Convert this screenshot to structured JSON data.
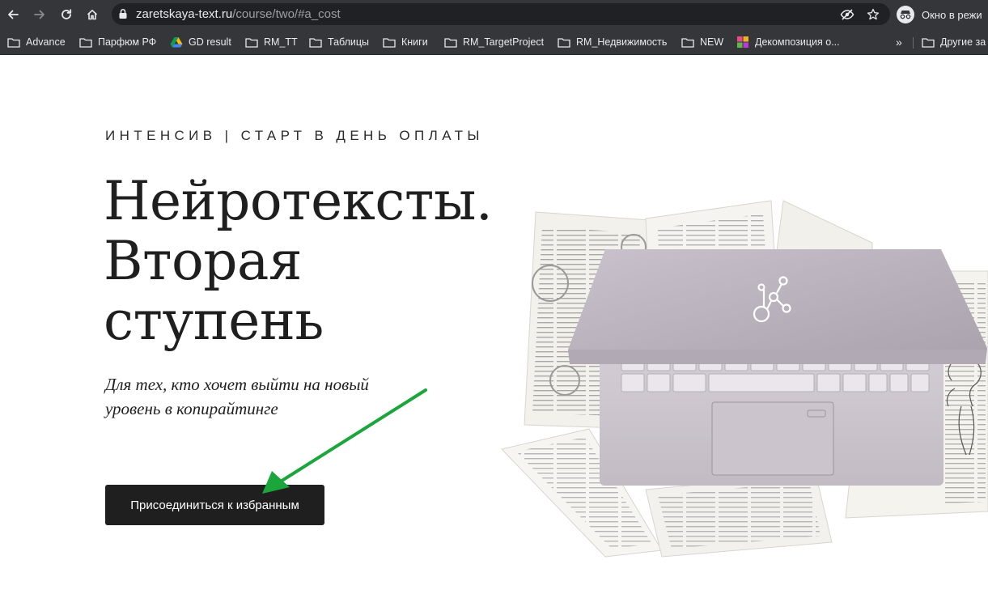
{
  "browser": {
    "url_host": "zaretskaya-text.ru",
    "url_path": "/course/two/#a_cost",
    "profile_label": "Окно в режи"
  },
  "bookmarks": [
    {
      "label": "Advance",
      "icon": "folder-icon"
    },
    {
      "label": "Парфюм РФ",
      "icon": "folder-icon"
    },
    {
      "label": "GD result",
      "icon": "google-drive-icon"
    },
    {
      "label": "RM_TT",
      "icon": "folder-icon"
    },
    {
      "label": "Таблицы",
      "icon": "folder-icon"
    },
    {
      "label": "Книги",
      "icon": "folder-icon"
    },
    {
      "label": "RM_TargetProject",
      "icon": "folder-icon"
    },
    {
      "label": "RM_Недвижимость",
      "icon": "folder-icon"
    },
    {
      "label": "NEW",
      "icon": "folder-icon"
    },
    {
      "label": "Декомпозиция о...",
      "icon": "app-grid-icon"
    }
  ],
  "bookmarks_more": "»",
  "bookmarks_other": "Другие за",
  "page": {
    "eyebrow": "ИНТЕНСИВ | СТАРТ В ДЕНЬ ОПЛАТЫ",
    "title_lines": [
      "Нейротексты.",
      "Вторая",
      "ступень"
    ],
    "subtitle": "Для тех, кто хочет выйти на новый уровень в копирайтинге",
    "cta_label": "Присоединиться к избранным"
  },
  "colors": {
    "chrome_bg": "#35363a",
    "omnibox_bg": "#202124",
    "cta_bg": "#1f1f1f",
    "annotation_arrow": "#1aa63a"
  }
}
